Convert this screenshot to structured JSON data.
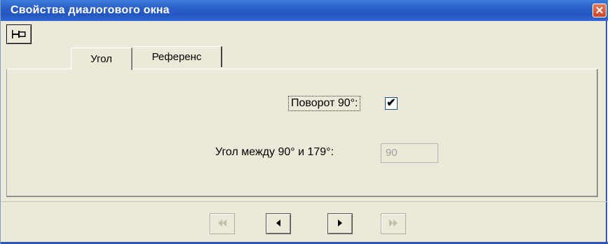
{
  "window": {
    "title": "Свойства диалогового окна",
    "close_symbol": "✕"
  },
  "tabs": [
    {
      "label": "Угол",
      "selected": true
    },
    {
      "label": "Референс",
      "selected": false
    }
  ],
  "panel": {
    "rotate_label": "Поворот 90°:",
    "rotate_checked": true,
    "rotate_check_symbol": "✔",
    "angle_label": "Угол между 90° и 179°:",
    "angle_value": "90",
    "angle_enabled": false
  },
  "nav": {
    "first_symbol": "⏮",
    "prev_symbol": "◀",
    "next_symbol": "▶",
    "last_symbol": "⏭",
    "first_enabled": false,
    "prev_enabled": true,
    "next_enabled": true,
    "last_enabled": false
  },
  "colors": {
    "titlebar": "#2a5ec6",
    "face": "#ece9d8",
    "close": "#c8462a"
  },
  "icons": {
    "pin": "pin-icon",
    "close": "close-icon"
  }
}
